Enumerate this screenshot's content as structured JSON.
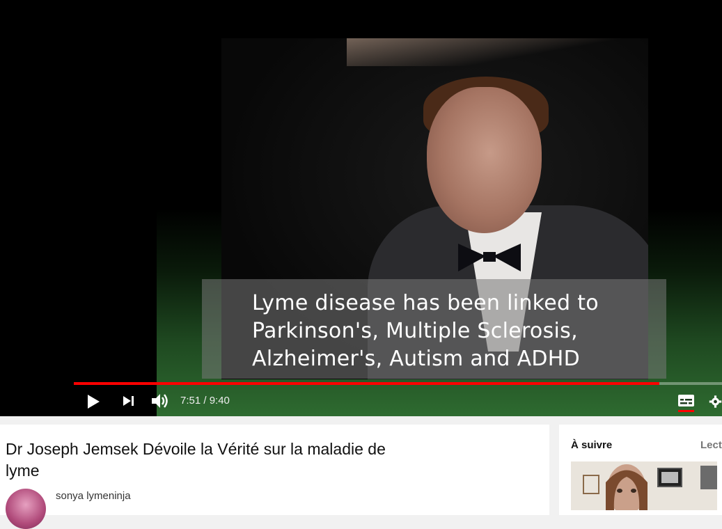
{
  "video": {
    "caption_lines": [
      "Lyme disease has been linked to",
      "Parkinson's, Multiple Sclerosis,",
      "Alzheimer's, Autism and ADHD"
    ],
    "progress_fraction": 0.903,
    "time_display": "7:51 / 9:40"
  },
  "controls": {
    "play_icon": "play-icon",
    "next_icon": "next-icon",
    "volume_icon": "volume-icon",
    "subtitles_icon": "subtitles-icon",
    "settings_icon": "gear-icon"
  },
  "info": {
    "title": "Dr Joseph Jemsek Dévoile la Vérité sur la maladie de lyme",
    "channel": "sonya lymeninja"
  },
  "sidebar": {
    "up_next_label": "À suivre",
    "autoplay_label": "Lect"
  },
  "colors": {
    "progress": "#ff0000",
    "player_bg": "#000000"
  }
}
